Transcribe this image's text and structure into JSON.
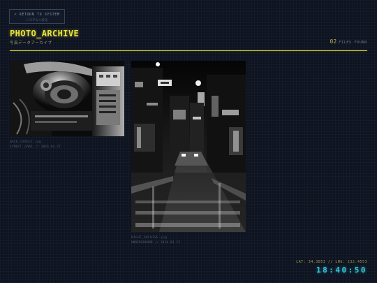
{
  "back_button": {
    "line1": "< RETURN TO SYSTEM",
    "line2": "システムへ戻る"
  },
  "header": {
    "title": "PHOTO_ARCHIVE",
    "subtitle": "写真データアーカイブ",
    "file_count": "02",
    "file_count_label": "FILES FOUND"
  },
  "photos": [
    {
      "filename": "BACK_STREET.jpg",
      "meta": "STREET_LEVEL // 2026.03.27",
      "icon": "machinery-photo"
    },
    {
      "filename": "NIGHT_ARCHIVE.jpg",
      "meta": "UNDERGROUND // 2026.03.12",
      "icon": "night-street-photo"
    }
  ],
  "footer": {
    "coords": "LAT: 34.3853 // LNG: 132.4553",
    "clock": "18:40:50"
  },
  "colors": {
    "accent": "#e8e23a",
    "clock": "#33c6d8",
    "background": "#0d1320"
  }
}
